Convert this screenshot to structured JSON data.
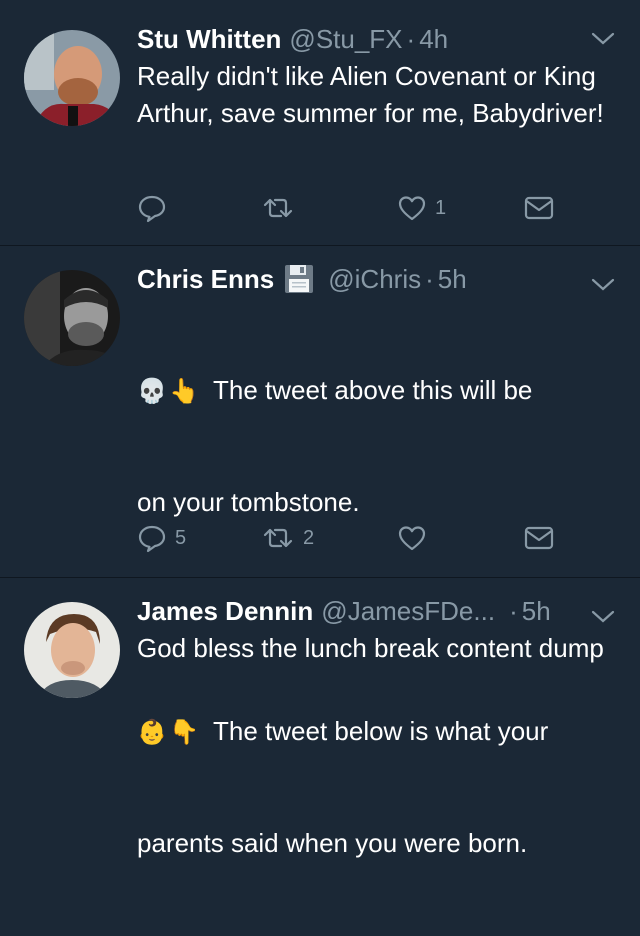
{
  "tweets": [
    {
      "name": "Stu Whitten",
      "handle": "@Stu_FX",
      "dot": "·",
      "time": "4h",
      "text": "Really didn't like Alien Covenant or King Arthur, save summer for me, Babydriver!",
      "reply_count": "",
      "retweet_count": "",
      "like_count": "1"
    },
    {
      "name": "Chris Enns",
      "name_emoji": "floppy-disk",
      "handle": "@iChris",
      "dot": "·",
      "time": "5h",
      "line1_emoji1": "💀",
      "line1_emoji2": "👆",
      "line1_text": "The tweet above this will be",
      "line2_text": "on your tombstone.",
      "line3_emoji1": "👶",
      "line3_emoji2": "👇",
      "line3_text": "The tweet below is what your",
      "line4_text": "parents said when you were born.",
      "reply_count": "5",
      "retweet_count": "2",
      "like_count": ""
    },
    {
      "name": "James Dennin",
      "handle": "@JamesFDe...",
      "dot": "·",
      "time": "5h",
      "text": "God bless the lunch break content dump"
    }
  ],
  "colors": {
    "background": "#1b2836",
    "secondary_text": "#8899a6",
    "divider": "#0f1720"
  }
}
